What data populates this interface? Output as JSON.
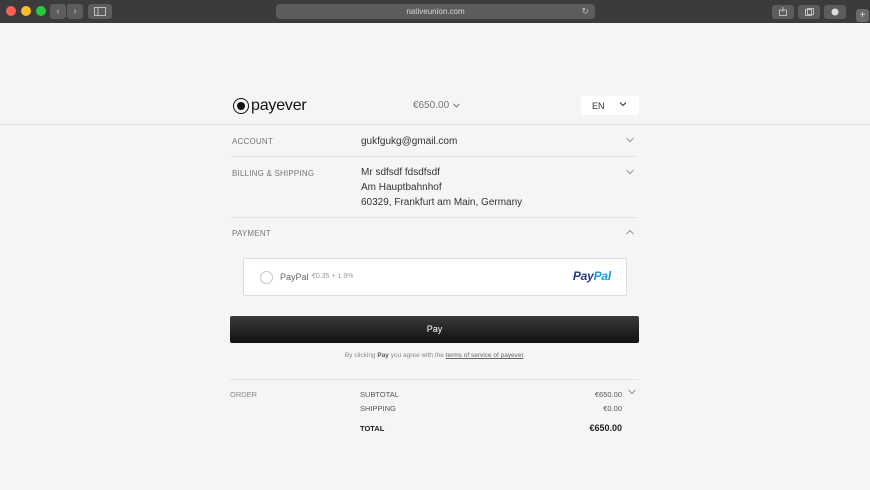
{
  "browser": {
    "url": "nativeunion.com",
    "nav_back": "‹",
    "nav_forward": "›",
    "reload_icon": "↻"
  },
  "header": {
    "logo_text": "payever",
    "amount": "€650.00",
    "language": "EN"
  },
  "sections": {
    "account": {
      "label": "ACCOUNT",
      "value": "gukfgukg@gmail.com"
    },
    "billing": {
      "label": "BILLING & SHIPPING",
      "name": "Mr sdfsdf fdsdfsdf",
      "street": "Am Hauptbahnhof",
      "city": "60329, Frankfurt am Main, Germany"
    },
    "payment": {
      "label": "PAYMENT"
    }
  },
  "payment_option": {
    "name": "PayPal",
    "fee": "€0.35 + 1.9%",
    "logo_part1": "Pay",
    "logo_part2": "Pal"
  },
  "pay_button": "Pay",
  "terms": {
    "prefix": "By clicking ",
    "bold": "Pay",
    "middle": " you agree with the ",
    "link": "terms of service of payever",
    "suffix": "."
  },
  "order": {
    "label": "ORDER",
    "subtotal_label": "SUBTOTAL",
    "subtotal_value": "€650.00",
    "shipping_label": "SHIPPING",
    "shipping_value": "€0.00",
    "total_label": "TOTAL",
    "total_value": "€650.00"
  }
}
